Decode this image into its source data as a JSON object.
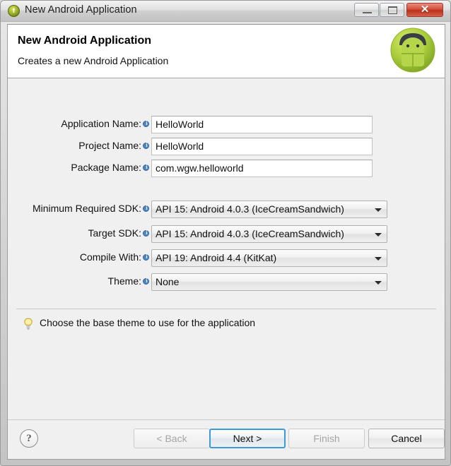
{
  "window": {
    "title": "New Android Application",
    "icon": "android-app-icon",
    "controls": {
      "minimize": "minimize-button",
      "maximize": "restore-button",
      "close": "close-button",
      "close_glyph": "✕"
    }
  },
  "header": {
    "title": "New Android Application",
    "description": "Creates a new Android Application",
    "image": "android-robot-icon"
  },
  "form": {
    "fields": [
      {
        "label": "Application Name:",
        "value": "HelloWorld",
        "type": "text",
        "name": "application-name"
      },
      {
        "label": "Project Name:",
        "value": "HelloWorld",
        "type": "text",
        "name": "project-name"
      },
      {
        "label": "Package Name:",
        "value": "com.wgw.helloworld",
        "type": "text",
        "name": "package-name"
      }
    ],
    "dropdowns": [
      {
        "label": "Minimum Required SDK:",
        "value": "API 15: Android 4.0.3 (IceCreamSandwich)",
        "name": "minimum-required-sdk"
      },
      {
        "label": "Target SDK:",
        "value": "API 15: Android 4.0.3 (IceCreamSandwich)",
        "name": "target-sdk"
      },
      {
        "label": "Compile With:",
        "value": "API 19: Android 4.4 (KitKat)",
        "name": "compile-with"
      },
      {
        "label": "Theme:",
        "value": "None",
        "name": "theme"
      }
    ]
  },
  "hint": {
    "icon": "lightbulb-icon",
    "text": "Choose the base theme to use for the application"
  },
  "footer": {
    "help_label": "?",
    "buttons": [
      {
        "label": "< Back",
        "state": "disabled"
      },
      {
        "label": "Next >",
        "state": "focused"
      },
      {
        "label": "Finish",
        "state": "disabled"
      },
      {
        "label": "Cancel",
        "state": "enabled"
      }
    ]
  },
  "colors": {
    "accent_focus": "#3c9ad6",
    "close_button": "#bc2f18",
    "info_icon": "#4a86c7",
    "android_green": "#a4c639",
    "dialog_bg": "#f0f0f0"
  }
}
